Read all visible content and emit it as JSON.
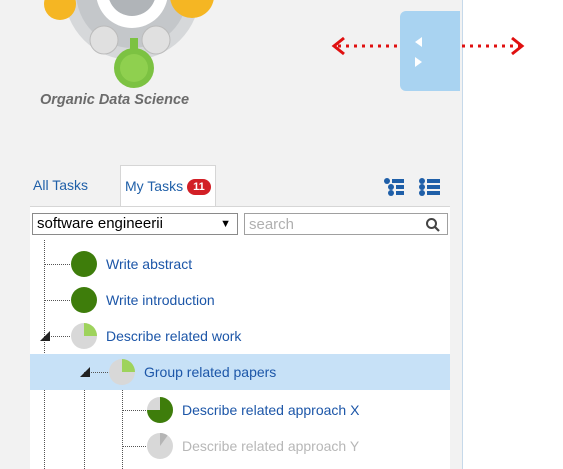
{
  "branding": {
    "logo_text": "Organic Data Science"
  },
  "tabs": {
    "all_tasks": "All Tasks",
    "my_tasks": "My Tasks",
    "my_tasks_count": "11"
  },
  "filter": {
    "selected": "software engineerii",
    "search_placeholder": "search"
  },
  "tasks": [
    {
      "label": "Write abstract",
      "progress": 1.0
    },
    {
      "label": "Write introduction",
      "progress": 1.0
    },
    {
      "label": "Describe related work",
      "progress": 0.25
    },
    {
      "label": "Group related papers",
      "progress": 0.25
    },
    {
      "label": "Describe related approach X",
      "progress": 0.75
    },
    {
      "label": "Describe related approach Y",
      "progress": 0.1
    }
  ],
  "colors": {
    "accent": "#1c56a8",
    "progress_done": "#3e7d0b",
    "progress_partial": "#9ed35c",
    "progress_empty": "#d8d8d8",
    "selected_row": "#c7e1f7",
    "badge": "#d21f26",
    "resize_arrow": "#e01010"
  }
}
